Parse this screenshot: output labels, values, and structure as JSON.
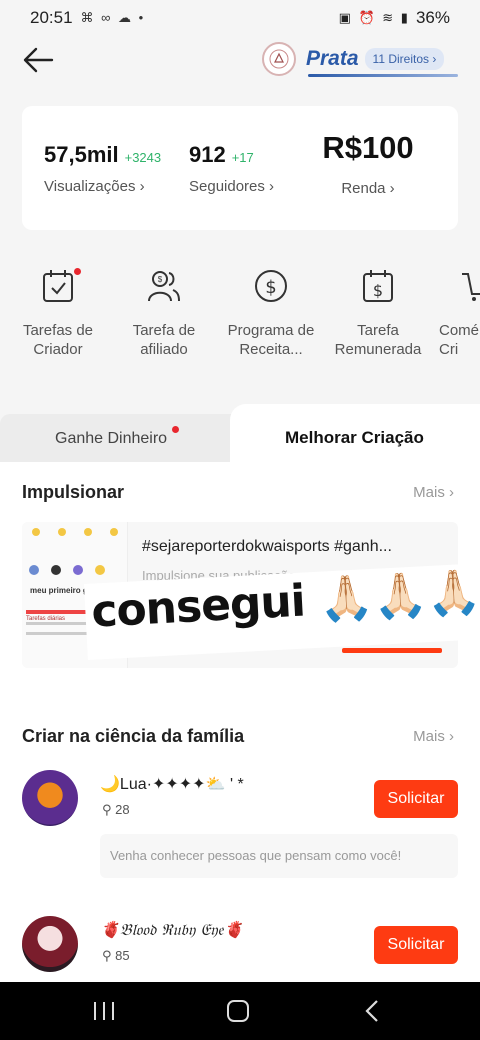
{
  "status_bar": {
    "time": "20:51",
    "left_icons": "⌘ ∞ ☁ •",
    "right_icons": "▣ ⏰ ≋ ▮",
    "battery": "36%"
  },
  "header": {
    "tier_name": "Prata",
    "tier_benefits": "11 Direitos ›",
    "badge_logo_text": ""
  },
  "stats": {
    "views": {
      "value": "57,5mil",
      "delta": "+3243",
      "label": "Visualizações ›"
    },
    "followers": {
      "value": "912",
      "delta": "+17",
      "label": "Seguidores ›"
    },
    "income": {
      "value": "R$100",
      "label": "Renda ›"
    }
  },
  "tools": [
    {
      "label": "Tarefas de Criador",
      "icon": "calendar-check-icon"
    },
    {
      "label": "Tarefa de afiliado",
      "icon": "people-dollar-icon"
    },
    {
      "label": "Programa de Receita...",
      "icon": "dollar-circle-icon"
    },
    {
      "label": "Tarefa Remunerada",
      "icon": "calendar-dollar-icon"
    },
    {
      "label": "Comé Cri",
      "icon": "cart-icon"
    }
  ],
  "tabs": {
    "earn": "Ganhe Dinheiro",
    "improve": "Melhorar Criação"
  },
  "boost": {
    "title": "Impulsionar",
    "more": "Mais",
    "card_title": "#sejareporterdokwaisports #ganh...",
    "card_desc": "Impulsione sua publicação e...",
    "thumb_caption": "meu primeiro ganho",
    "thumb_sub": "Tarefas diárias"
  },
  "overlay_caption": "consegui 🙏🏻🙏🏻🙏🏻",
  "family": {
    "title": "Criar na ciência da família",
    "more": "Mais",
    "groups": [
      {
        "name": "🌙Lua·✦✦✦✦⛅ ' *",
        "members": "28",
        "button": "Solicitar",
        "desc": "Venha conhecer pessoas que pensam como você!"
      },
      {
        "name": "🫀𝔅𝔩𝔬𝔬𝔡 ℜ𝔲𝔟𝔶 𝔈𝔶𝔢🫀",
        "members": "85",
        "button": "Solicitar"
      }
    ]
  },
  "colors": {
    "accent": "#fe3b12",
    "tier_blue": "#2b5aa8",
    "delta_green": "#2fb36a",
    "notif_red": "#e8272e"
  }
}
